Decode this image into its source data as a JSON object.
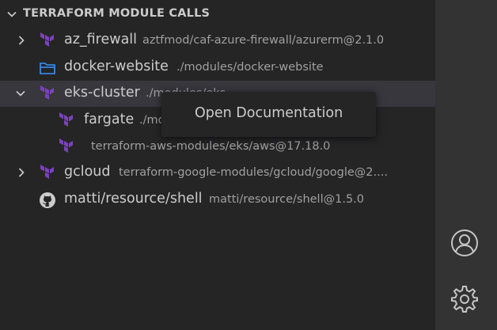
{
  "section": {
    "title": "TERRAFORM MODULE CALLS"
  },
  "items": [
    {
      "label": "az_firewall",
      "description": "aztfmod/caf-azure-firewall/azurerm@2.1.0",
      "icon": "terraform-icon",
      "expanded": false
    },
    {
      "label": "docker-website",
      "description": "./modules/docker-website",
      "icon": "folder-icon"
    },
    {
      "label": "eks-cluster",
      "description": "./modules/eks",
      "icon": "terraform-icon",
      "expanded": true,
      "selected": true
    },
    {
      "label": "fargate",
      "description": "./modules/fargate",
      "icon": "terraform-icon"
    },
    {
      "label": "",
      "description": "terraform-aws-modules/eks/aws@17.18.0",
      "icon": "terraform-icon"
    },
    {
      "label": "gcloud",
      "description": "terraform-google-modules/gcloud/google@2....",
      "icon": "terraform-icon",
      "expanded": false
    },
    {
      "label": "matti/resource/shell",
      "description": "matti/resource/shell@1.5.0",
      "icon": "github-icon"
    }
  ],
  "context_menu": {
    "items": [
      "Open Documentation"
    ]
  },
  "activity_bar": {
    "icons": [
      "account-icon",
      "gear-icon"
    ]
  },
  "colors": {
    "terraform": "#7b42bc",
    "folder": "#3794ff",
    "panel": "#252526",
    "activity_bar": "#333333",
    "selection": "#37373d"
  }
}
